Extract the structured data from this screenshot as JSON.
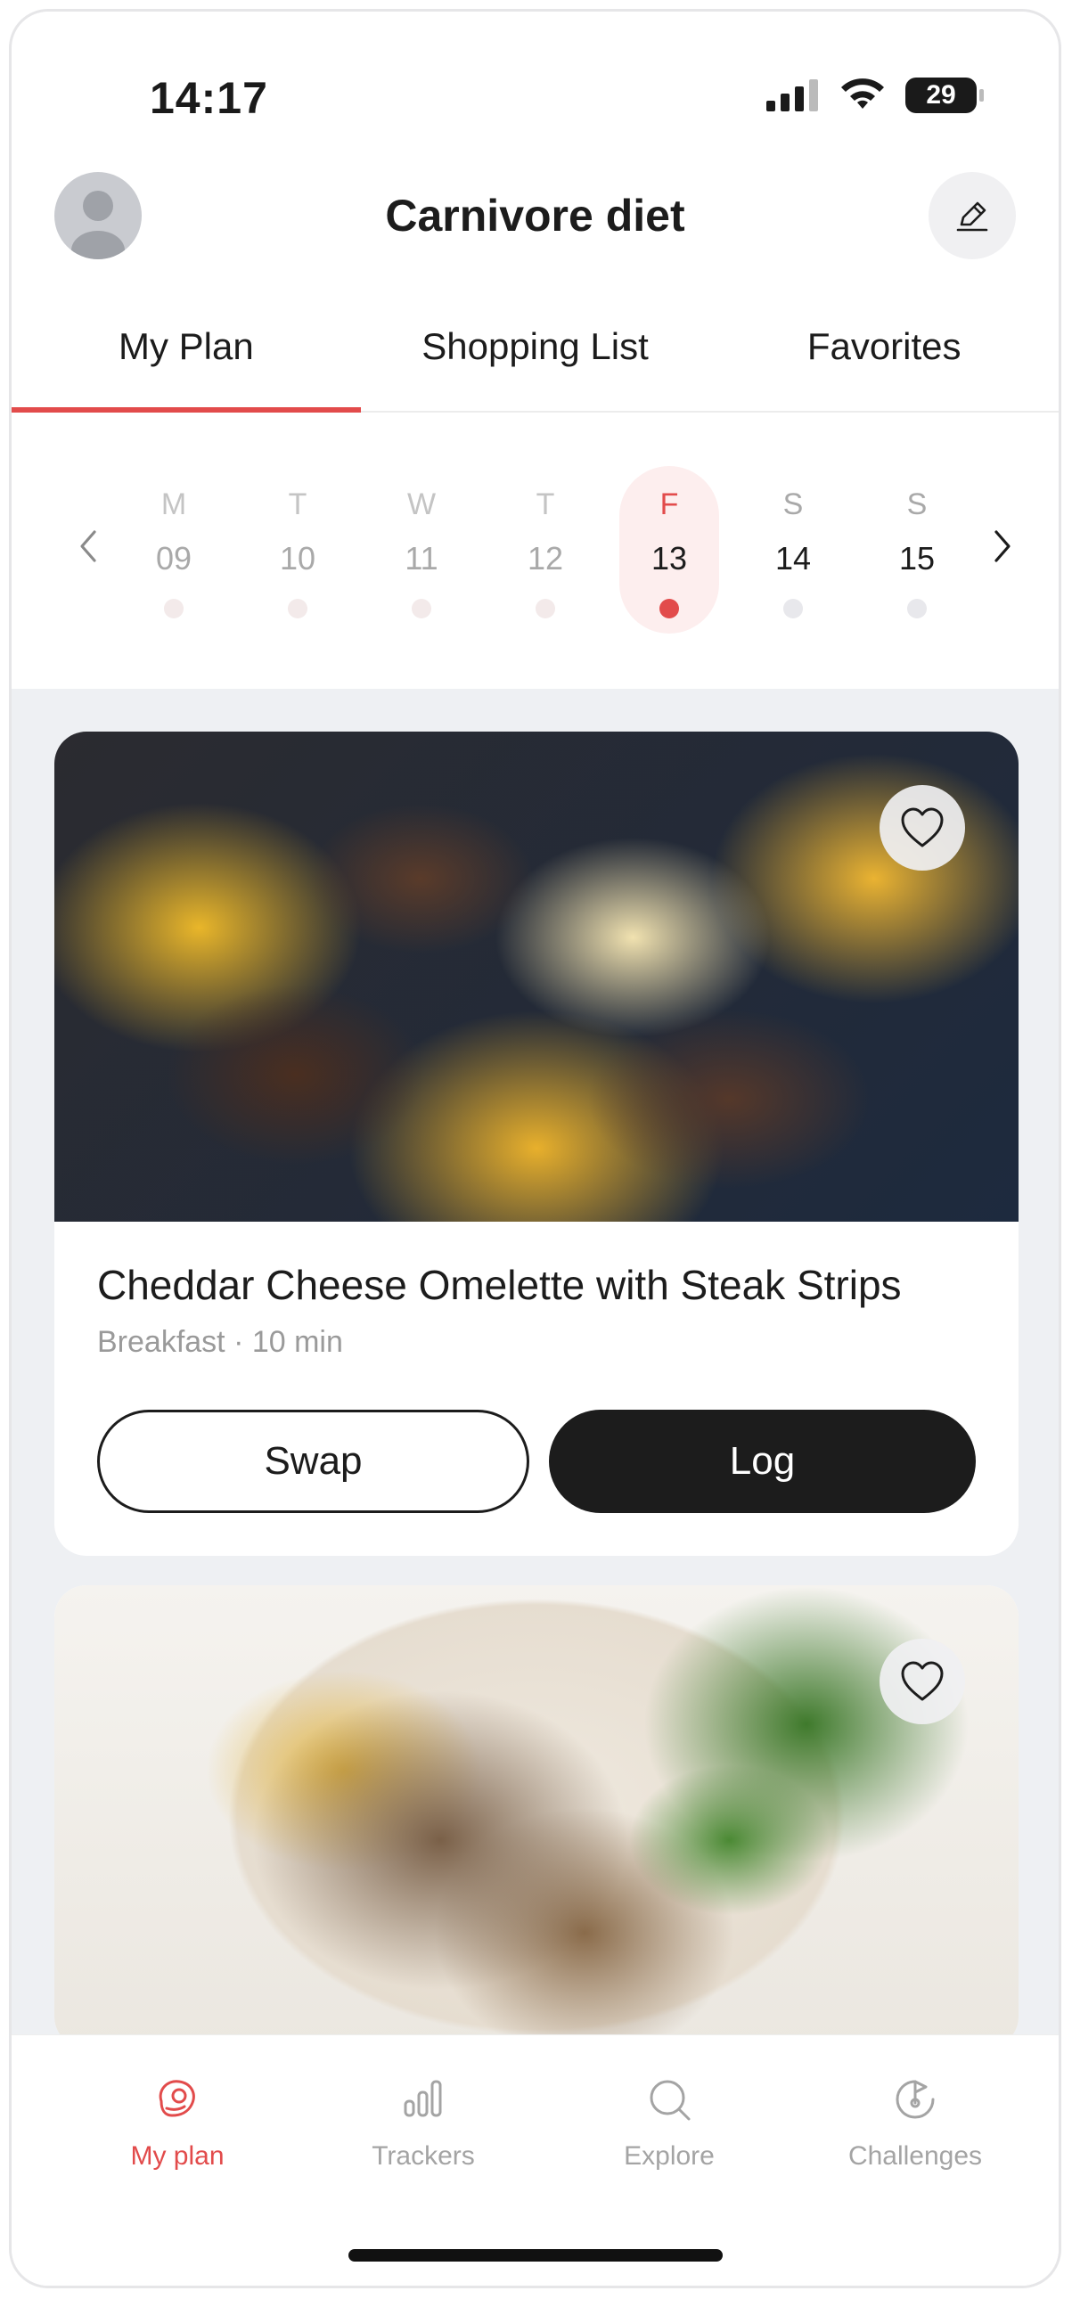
{
  "status": {
    "time": "14:17",
    "battery": "29"
  },
  "header": {
    "title": "Carnivore diet"
  },
  "tabs": [
    {
      "label": "My Plan",
      "active": true
    },
    {
      "label": "Shopping List",
      "active": false
    },
    {
      "label": "Favorites",
      "active": false
    }
  ],
  "week": {
    "days": [
      {
        "letter": "M",
        "num": "09"
      },
      {
        "letter": "T",
        "num": "10"
      },
      {
        "letter": "W",
        "num": "11"
      },
      {
        "letter": "T",
        "num": "12"
      },
      {
        "letter": "F",
        "num": "13"
      },
      {
        "letter": "S",
        "num": "14"
      },
      {
        "letter": "S",
        "num": "15"
      }
    ],
    "selected_index": 4
  },
  "meals": [
    {
      "title": "Cheddar Cheese Omelette with Steak Strips",
      "meta": "Breakfast · 10 min",
      "swap_label": "Swap",
      "log_label": "Log"
    },
    {
      "title": "",
      "meta": ""
    }
  ],
  "bottom_nav": [
    {
      "label": "My plan",
      "icon": "steak-icon",
      "active": true
    },
    {
      "label": "Trackers",
      "icon": "bar-chart-icon",
      "active": false
    },
    {
      "label": "Explore",
      "icon": "search-icon",
      "active": false
    },
    {
      "label": "Challenges",
      "icon": "challenge-icon",
      "active": false
    }
  ],
  "colors": {
    "accent": "#e24b4b",
    "dark": "#1c1c1c",
    "feed_bg": "#eef0f3"
  }
}
